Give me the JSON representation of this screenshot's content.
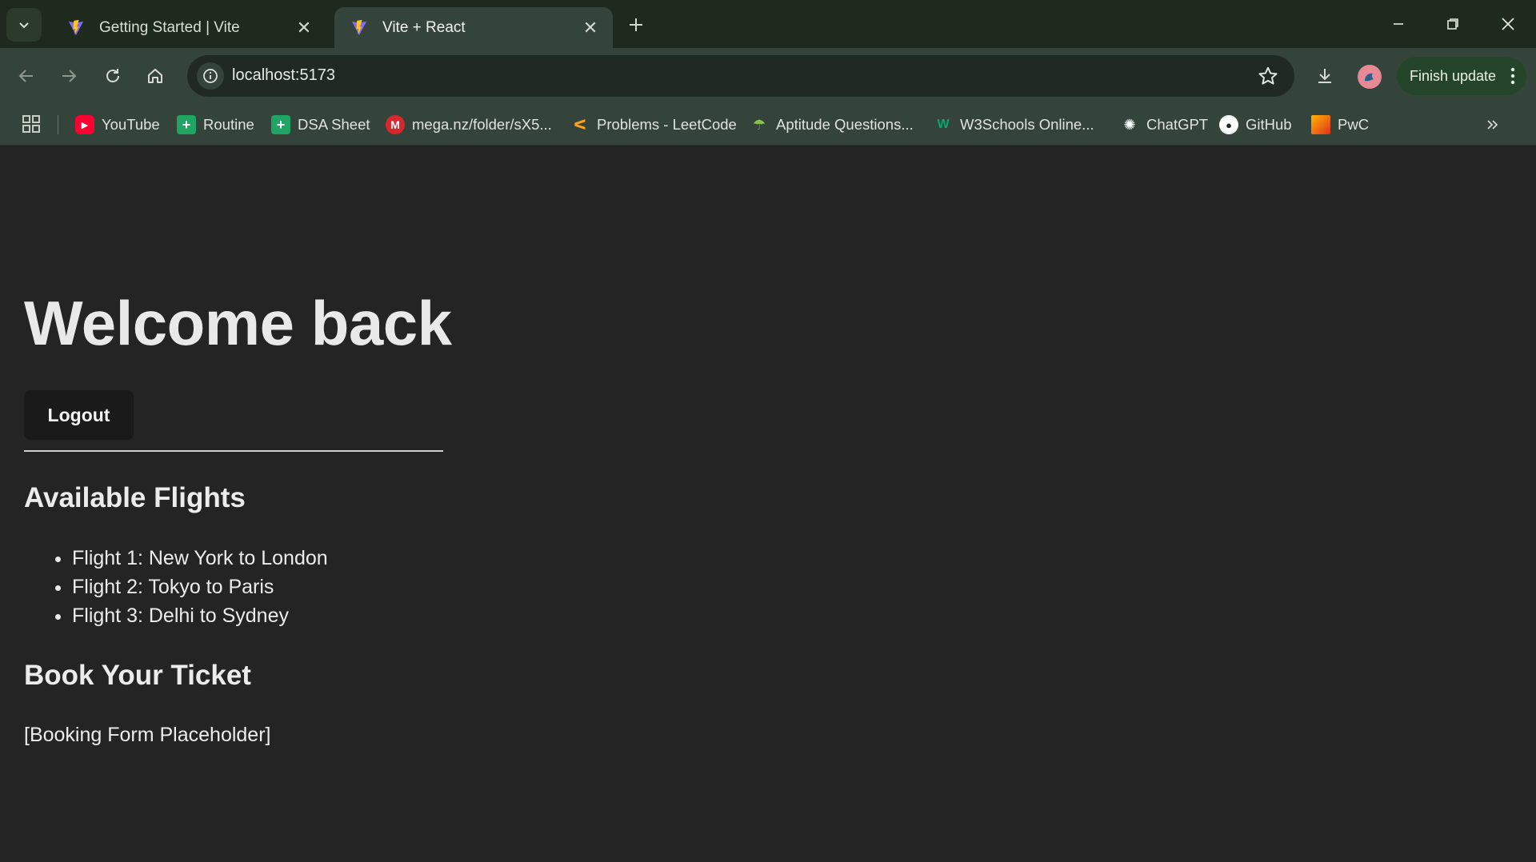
{
  "browser": {
    "tabs": [
      {
        "title": "Getting Started | Vite",
        "active": false,
        "favicon": "vite-logo-icon"
      },
      {
        "title": "Vite + React",
        "active": true,
        "favicon": "vite-logo-icon"
      }
    ],
    "address": "localhost:5173",
    "update_button": "Finish update",
    "bookmarks": [
      {
        "label": "YouTube",
        "icon": "youtube-icon",
        "color": "#ff0033"
      },
      {
        "label": "Routine",
        "icon": "sheets-icon",
        "color": "#1fa463"
      },
      {
        "label": "DSA Sheet",
        "icon": "sheets-icon",
        "color": "#1fa463"
      },
      {
        "label": "mega.nz/folder/sX5...",
        "icon": "mega-icon",
        "color": "#d9272e"
      },
      {
        "label": "Problems - LeetCode",
        "icon": "leetcode-icon",
        "color": "#ffa116"
      },
      {
        "label": "Aptitude Questions...",
        "icon": "indiabix-icon",
        "color": "#8bc34a"
      },
      {
        "label": "W3Schools Online...",
        "icon": "w3schools-icon",
        "color": "#04aa6d"
      },
      {
        "label": "ChatGPT",
        "icon": "chatgpt-icon",
        "color": "#ffffff"
      },
      {
        "label": "GitHub",
        "icon": "github-icon",
        "color": "#ffffff"
      },
      {
        "label": "PwC",
        "icon": "pwc-icon",
        "color": "#e0301e"
      }
    ]
  },
  "page": {
    "heading": "Welcome back",
    "logout_label": "Logout",
    "flights_heading": "Available Flights",
    "flights": [
      "Flight 1: New York to London",
      "Flight 2: Tokyo to Paris",
      "Flight 3: Delhi to Sydney"
    ],
    "booking_heading": "Book Your Ticket",
    "booking_placeholder": "[Booking Form Placeholder]"
  },
  "colors": {
    "page_background": "#242424",
    "browser_frame": "#35443a",
    "tab_strip": "#1e2a1e"
  }
}
